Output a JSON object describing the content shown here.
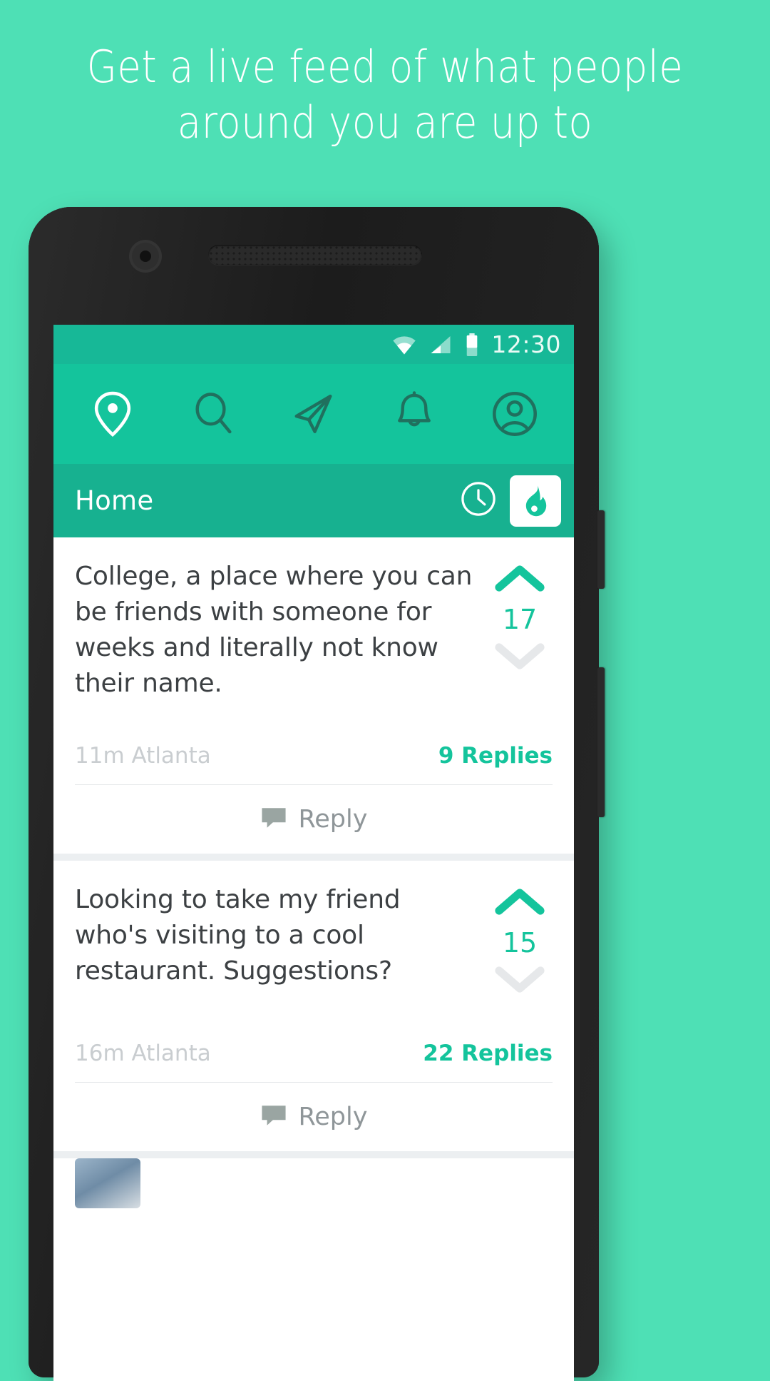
{
  "promo": {
    "headline_line1": "Get a live feed of what people",
    "headline_line2": "around you are up to",
    "background_color": "#4EE0B5",
    "text_color": "#FFFFFF"
  },
  "device": {
    "frame_color": "#232323",
    "camera": "front-camera",
    "speaker": "earpiece-speaker"
  },
  "statusbar": {
    "wifi": "wifi-icon",
    "signal": "cellular-signal-icon",
    "battery": "battery-icon",
    "time": "12:30",
    "background_color": "#17b897"
  },
  "toolbar": {
    "background_color": "#14c49c",
    "items": [
      {
        "name": "location-pin-icon",
        "label": "Nearby",
        "active": true
      },
      {
        "name": "search-icon",
        "label": "Search",
        "active": false
      },
      {
        "name": "paper-plane-icon",
        "label": "Post",
        "active": false
      },
      {
        "name": "bell-icon",
        "label": "Notifications",
        "active": false
      },
      {
        "name": "profile-icon",
        "label": "Profile",
        "active": false
      }
    ]
  },
  "header": {
    "title": "Home",
    "background_color": "#17b190",
    "actions": [
      {
        "name": "clock-icon",
        "label": "Recent",
        "active": false
      },
      {
        "name": "flame-icon",
        "label": "Hot",
        "active": true
      }
    ]
  },
  "feed": {
    "accent_color": "#14c49c",
    "reply_label": "Reply",
    "posts": [
      {
        "text": "College, a place where you can be friends with someone for weeks and literally not know their name.",
        "votes": "17",
        "time": "11m",
        "location": "Atlanta",
        "meta": "11m Atlanta",
        "replies": "9 Replies"
      },
      {
        "text": "Looking to take my friend who's visiting to a cool restaurant. Suggestions?",
        "votes": "15",
        "time": "16m",
        "location": "Atlanta",
        "meta": "16m Atlanta",
        "replies": "22 Replies"
      }
    ]
  }
}
